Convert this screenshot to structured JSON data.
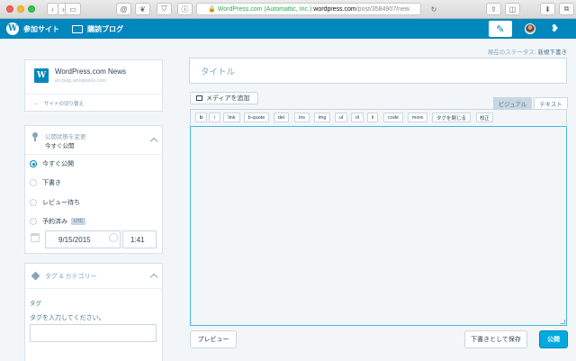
{
  "browser": {
    "url_org": "WordPress.com (Automattic, Inc.)",
    "url_host": "wordpress.com",
    "url_path": "/post/3584907/new"
  },
  "masterbar": {
    "my_sites": "参加サイト",
    "reader": "購読ブログ"
  },
  "status": {
    "label": "現在のステータス:",
    "value": "新規下書き"
  },
  "site": {
    "title": "WordPress.com News",
    "url": "en.blog.wordpress.com",
    "switch_label": "サイトの切り替え"
  },
  "publish": {
    "heading": "公開状態を変更",
    "current": "今すぐ公開",
    "options": [
      "今すぐ公開",
      "下書き",
      "レビュー待ち",
      "予約済み"
    ],
    "selected_index": 0,
    "utc_badge": "UTC",
    "date": "9/15/2015",
    "time": "1:41"
  },
  "tags": {
    "heading": "タグ & カテゴリー",
    "label": "タグ",
    "hint": "タグを入力してください。"
  },
  "editor": {
    "title_placeholder": "タイトル",
    "add_media": "メディアを追加",
    "tab_visual": "ビジュアル",
    "tab_text": "テキスト",
    "quicktags": [
      "b",
      "i",
      "link",
      "b-quote",
      "del",
      "ins",
      "img",
      "ul",
      "ol",
      "li",
      "code",
      "more",
      "タグを閉じる",
      "校正"
    ]
  },
  "actions": {
    "preview": "プレビュー",
    "save_draft": "下書きとして保存",
    "publish": "公開"
  }
}
